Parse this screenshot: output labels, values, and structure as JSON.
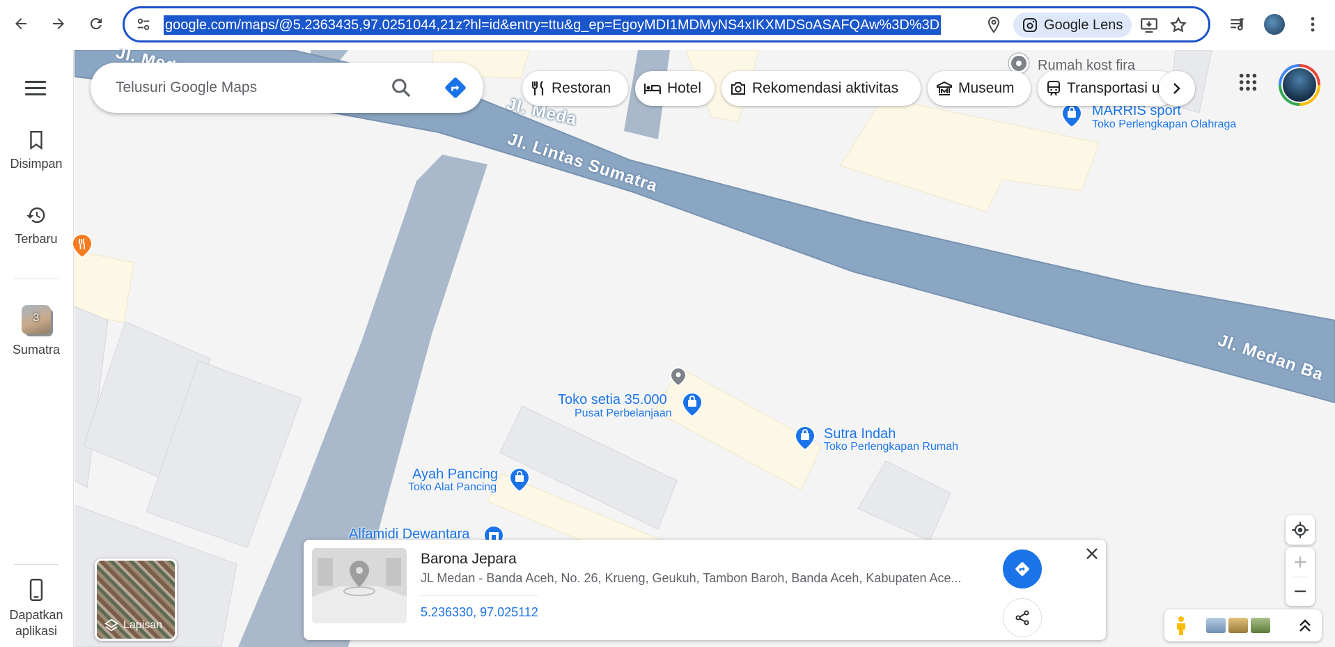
{
  "browser": {
    "url": "google.com/maps/@5.2363435,97.0251044,21z?hl=id&entry=ttu&g_ep=EgoyMDI1MDMyNS4xIKXMDSoASAFQAw%3D%3D",
    "lens_label": "Google Lens"
  },
  "sidebar": {
    "saved_label": "Disimpan",
    "recent_label": "Terbaru",
    "collection_label": "Sumatra",
    "collection_count": "3",
    "get_app_label_1": "Dapatkan",
    "get_app_label_2": "aplikasi"
  },
  "search": {
    "placeholder": "Telusuri Google Maps"
  },
  "chips": [
    {
      "label": "Restoran",
      "icon": "fork-knife-icon"
    },
    {
      "label": "Hotel",
      "icon": "bed-icon"
    },
    {
      "label": "Rekomendasi aktivitas",
      "icon": "camera-icon"
    },
    {
      "label": "Museum",
      "icon": "museum-icon"
    },
    {
      "label": "Transportasi u",
      "icon": "train-icon"
    }
  ],
  "map": {
    "roads": {
      "lintas_sumatra": "Jl. Lintas Sumatra",
      "medan_ba": "Jl. Medan Ba",
      "medan_top": "Jl. Meda"
    },
    "pois": {
      "rumah_kost": "Rumah kost fira",
      "marris_name": "MARRIS sport",
      "marris_cat": "Toko Perlengkapan Olahraga",
      "toko_setia_name": "Toko setia 35.000",
      "toko_setia_cat": "Pusat Perbelanjaan",
      "sutra_name": "Sutra Indah",
      "sutra_cat": "Toko Perlengkapan Rumah",
      "ayah_name": "Ayah Pancing",
      "ayah_cat": "Toko Alat Pancing",
      "alfamidi_name": "Alfamidi Dewantara"
    }
  },
  "layers": {
    "label": "Lapisan"
  },
  "info_card": {
    "title": "Barona Jepara",
    "address": "JL Medan - Banda Aceh, No. 26, Krueng, Geukuh, Tambon Baroh, Banda Aceh, Kabupaten Ace...",
    "coordinates": "5.236330, 97.025112"
  },
  "colors": {
    "accent": "#1a73e8",
    "road_main": "#8ba6c3",
    "map_bg": "#f4f4f4",
    "building": "#e8e9ed",
    "commercial": "#fdf7e6"
  }
}
